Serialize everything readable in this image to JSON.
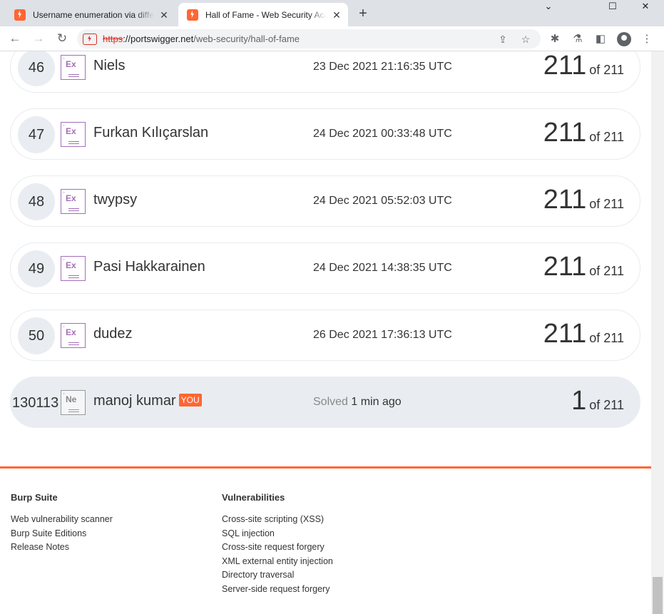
{
  "browser": {
    "tabs": [
      {
        "title": "Username enumeration via differ",
        "active": false
      },
      {
        "title": "Hall of Fame - Web Security Acad",
        "active": true
      }
    ],
    "url": {
      "scheme": "https",
      "host": "portswigger.net",
      "path": "/web-security/hall-of-fame"
    }
  },
  "leaderboard": {
    "entries": [
      {
        "rank": "46",
        "badge": "Ex",
        "name": "Niels",
        "date": "23 Dec 2021 21:16:35 UTC",
        "score": "211",
        "total": "of 211"
      },
      {
        "rank": "47",
        "badge": "Ex",
        "name": "Furkan Kılıçarslan",
        "date": "24 Dec 2021 00:33:48 UTC",
        "score": "211",
        "total": "of 211"
      },
      {
        "rank": "48",
        "badge": "Ex",
        "name": "twypsy",
        "date": "24 Dec 2021 05:52:03 UTC",
        "score": "211",
        "total": "of 211"
      },
      {
        "rank": "49",
        "badge": "Ex",
        "name": "Pasi Hakkarainen",
        "date": "24 Dec 2021 14:38:35 UTC",
        "score": "211",
        "total": "of 211"
      },
      {
        "rank": "50",
        "badge": "Ex",
        "name": "dudez",
        "date": "26 Dec 2021 17:36:13 UTC",
        "score": "211",
        "total": "of 211"
      }
    ],
    "current_user": {
      "rank": "130113",
      "badge": "Ne",
      "name": "manoj kumar",
      "tag": "YOU",
      "solved_label": "Solved",
      "solved_when": "1 min ago",
      "score": "1",
      "total": "of 211"
    }
  },
  "footer": {
    "columns": [
      {
        "heading": "Burp Suite",
        "links": [
          "Web vulnerability scanner",
          "Burp Suite Editions",
          "Release Notes"
        ]
      },
      {
        "heading": "Vulnerabilities",
        "links": [
          "Cross-site scripting (XSS)",
          "SQL injection",
          "Cross-site request forgery",
          "XML external entity injection",
          "Directory traversal",
          "Server-side request forgery"
        ]
      }
    ]
  },
  "colors": {
    "accent": "#ff6633",
    "badge_expert": "#a36fb7",
    "row_highlight": "#e9edf1"
  },
  "icons": [
    "back-icon",
    "forward-icon",
    "reload-icon",
    "insecure-warning-icon",
    "share-icon",
    "bookmark-star-icon",
    "extensions-icon",
    "lab-flask-icon",
    "side-panel-icon",
    "profile-icon",
    "menu-dots-icon",
    "minimize-icon",
    "maximize-icon",
    "close-window-icon"
  ]
}
